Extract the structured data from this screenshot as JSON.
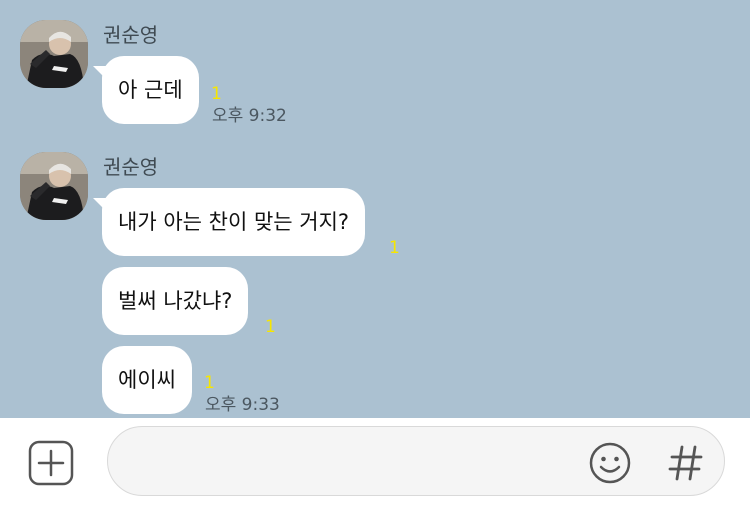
{
  "chat": {
    "groups": [
      {
        "sender": "권순영",
        "messages": [
          {
            "text": "아 근데",
            "unread": "1"
          }
        ],
        "time": "오후 9:32"
      },
      {
        "sender": "권순영",
        "messages": [
          {
            "text": "내가 아는 찬이 맞는 거지?",
            "unread": "1"
          },
          {
            "text": "벌써 나갔냐?",
            "unread": "1"
          },
          {
            "text": "에이씨",
            "unread": "1"
          }
        ],
        "time": "오후 9:33"
      }
    ]
  },
  "input_bar": {
    "placeholder": "",
    "icons": {
      "attach": "plus-square-icon",
      "emoji": "smiley-icon",
      "hashtag": "hash-icon"
    }
  },
  "colors": {
    "chat_background": "#abc1d1",
    "bubble": "#ffffff",
    "unread": "#f7e600",
    "input_field": "#f5f5f5"
  }
}
